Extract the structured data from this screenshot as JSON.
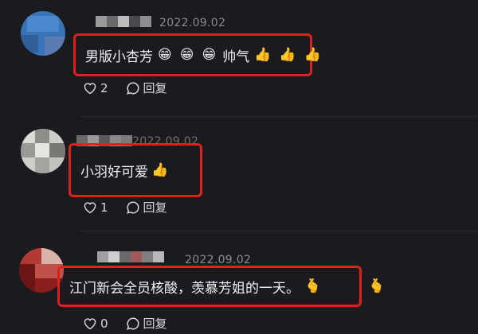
{
  "comments": [
    {
      "date": "2022.09.02",
      "text": "男版小杏芳",
      "emojis": [
        "😁",
        "😁",
        "😁"
      ],
      "trail_text": "帅气",
      "trail_emojis": [
        "👍",
        "👍",
        "👍"
      ],
      "likes": "2",
      "reply_label": "回复"
    },
    {
      "date": "2022.09.02",
      "text": "小羽好可爱",
      "emojis": [
        "👍"
      ],
      "likes": "1",
      "reply_label": "回复"
    },
    {
      "date": "2022.09.02",
      "text": "江门新会全员核酸，羡慕芳姐的一天。",
      "emojis": [
        "🫰",
        "🫰"
      ],
      "likes": "0",
      "reply_label": "回复"
    }
  ],
  "icons": {
    "like": "heart-outline-icon",
    "reply": "speech-bubble-icon"
  },
  "colors": {
    "highlight": "#e0201c",
    "background": "#1a1b1f"
  }
}
